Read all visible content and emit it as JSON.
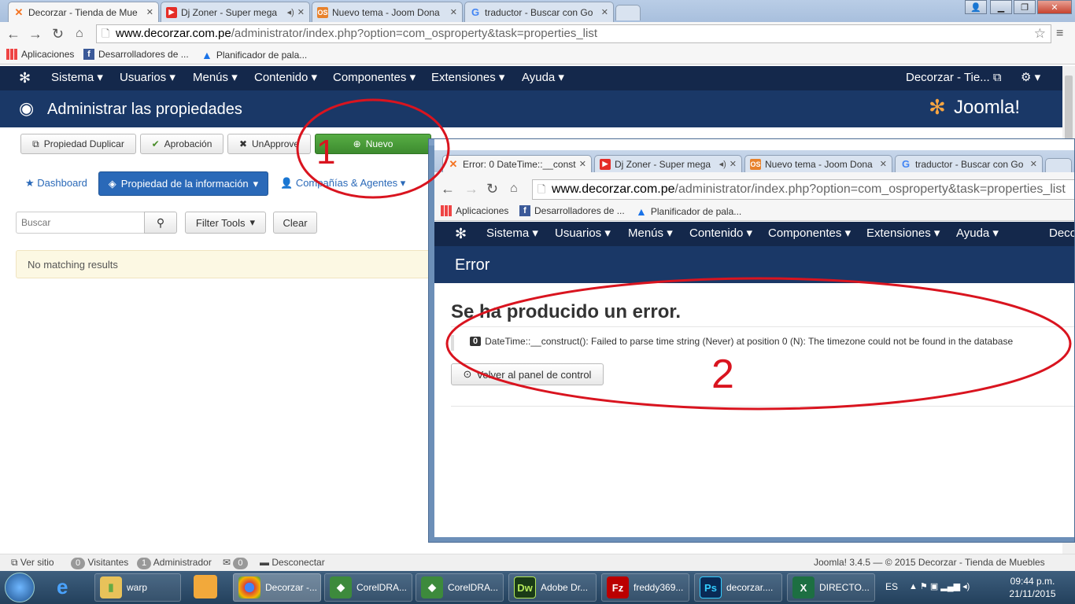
{
  "browser": {
    "tabs": [
      {
        "title": "Decorzar - Tienda de Mue",
        "icon": "joomla-icon"
      },
      {
        "title": "Dj Zoner - Super mega",
        "icon": "youtube-icon"
      },
      {
        "title": "Nuevo tema - Joom Dona",
        "icon": "os-icon"
      },
      {
        "title": "traductor - Buscar con Go",
        "icon": "google-icon"
      }
    ],
    "url_host": "www.decorzar.com.pe",
    "url_path": "/administrator/index.php?option=com_osproperty&task=properties_list",
    "bookmarks": [
      "Aplicaciones",
      "Desarrolladores de ...",
      "Planificador de pala..."
    ]
  },
  "joomla": {
    "menu": [
      "Sistema",
      "Usuarios",
      "Menús",
      "Contenido",
      "Componentes",
      "Extensiones",
      "Ayuda"
    ],
    "site_link": "Decorzar - Tie...",
    "page_title": "Administrar las propiedades",
    "logo_text": "Joomla!",
    "toolbar": {
      "duplicate": "Propiedad Duplicar",
      "approve": "Aprobación",
      "unapprove": "UnApprove",
      "new": "Nuevo"
    },
    "subnav": {
      "dashboard": "Dashboard",
      "info": "Propiedad de la información",
      "companies": "Compañías & Agentes"
    },
    "search_placeholder": "Buscar",
    "filter_tools": "Filter Tools",
    "clear": "Clear",
    "no_results": "No matching results",
    "status": {
      "view_site": "Ver sitio",
      "visitors_count": "0",
      "visitors": "Visitantes",
      "admin_count": "1",
      "admin": "Administrador",
      "msg_count": "0",
      "logout": "Desconectar",
      "footer": "Joomla! 3.4.5  —  © 2015 Decorzar - Tienda de Muebles"
    }
  },
  "popup": {
    "tabs": [
      {
        "title": "Error: 0 DateTime::__const",
        "icon": "joomla-icon"
      },
      {
        "title": "Dj Zoner - Super mega",
        "icon": "youtube-icon"
      },
      {
        "title": "Nuevo tema - Joom Dona",
        "icon": "os-icon"
      },
      {
        "title": "traductor - Buscar con Go",
        "icon": "google-icon"
      }
    ],
    "url_host": "www.decorzar.com.pe",
    "url_path": "/administrator/index.php?option=com_osproperty&task=properties_list",
    "bookmarks": [
      "Aplicaciones",
      "Desarrolladores de ...",
      "Planificador de pala..."
    ],
    "menu": [
      "Sistema",
      "Usuarios",
      "Menús",
      "Contenido",
      "Componentes",
      "Extensiones",
      "Ayuda"
    ],
    "site_link": "Deco",
    "header": "Error",
    "heading": "Se ha producido un error.",
    "error_code": "0",
    "error_message": "DateTime::__construct(): Failed to parse time string (Never) at position 0 (N): The timezone could not be found in the database",
    "back_button": "Volver al panel de control"
  },
  "annotations": {
    "one": "1",
    "two": "2",
    "color": "#d9141f"
  },
  "taskbar": {
    "items": [
      "warp",
      "Decorzar -...",
      "CorelDRA...",
      "CorelDRA...",
      "Adobe Dr...",
      "freddy369...",
      "decorzar....",
      "DIRECTO..."
    ],
    "lang": "ES",
    "time": "09:44 p.m.",
    "date": "21/11/2015"
  }
}
